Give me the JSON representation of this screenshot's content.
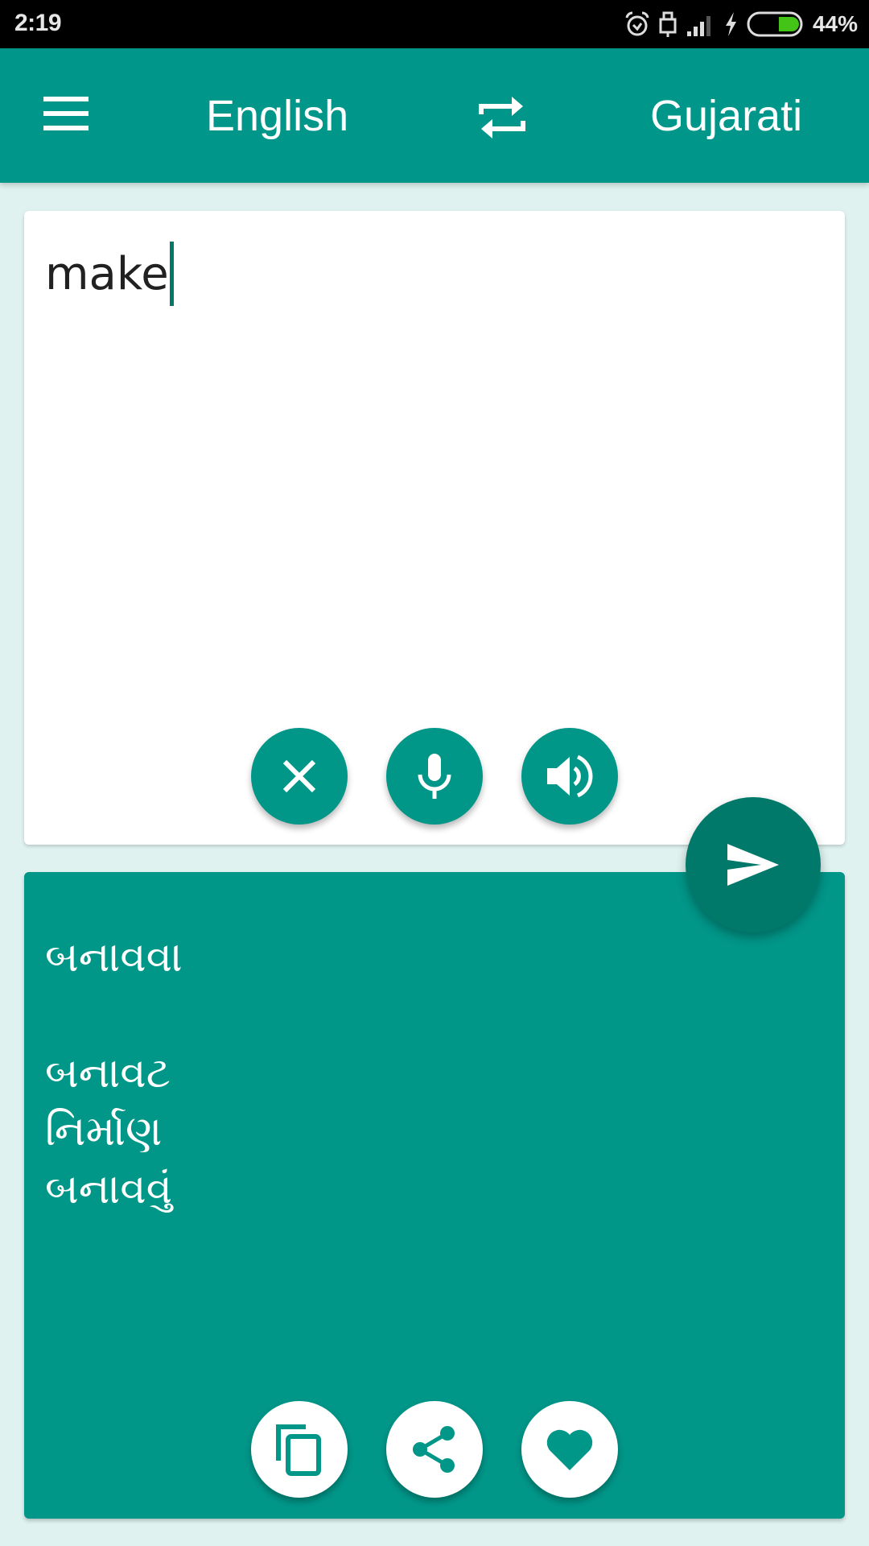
{
  "status_bar": {
    "time": "2:19",
    "battery_percent": "44%",
    "battery_level": 0.44,
    "icons": [
      "alarm-icon",
      "usb-lock-icon",
      "signal-icon",
      "charging-icon",
      "battery-icon"
    ]
  },
  "app_bar": {
    "menu_icon": "hamburger-menu-icon",
    "source_language": "English",
    "swap_icon": "swap-languages-icon",
    "target_language": "Gujarati",
    "color": "#00968a"
  },
  "input": {
    "text": "make",
    "actions": [
      {
        "name": "clear",
        "icon": "close-icon"
      },
      {
        "name": "voice-input",
        "icon": "microphone-icon"
      },
      {
        "name": "speak",
        "icon": "speaker-icon"
      }
    ]
  },
  "translate_button": {
    "icon": "send-icon",
    "color": "#00796b"
  },
  "output": {
    "primary": "બનાવવા",
    "alternatives": [
      "બનાવટ",
      "નિર્માણ",
      "બનાવવું"
    ],
    "actions": [
      {
        "name": "copy",
        "icon": "copy-icon"
      },
      {
        "name": "share",
        "icon": "share-icon"
      },
      {
        "name": "favorite",
        "icon": "heart-icon"
      }
    ],
    "color": "#009688"
  }
}
